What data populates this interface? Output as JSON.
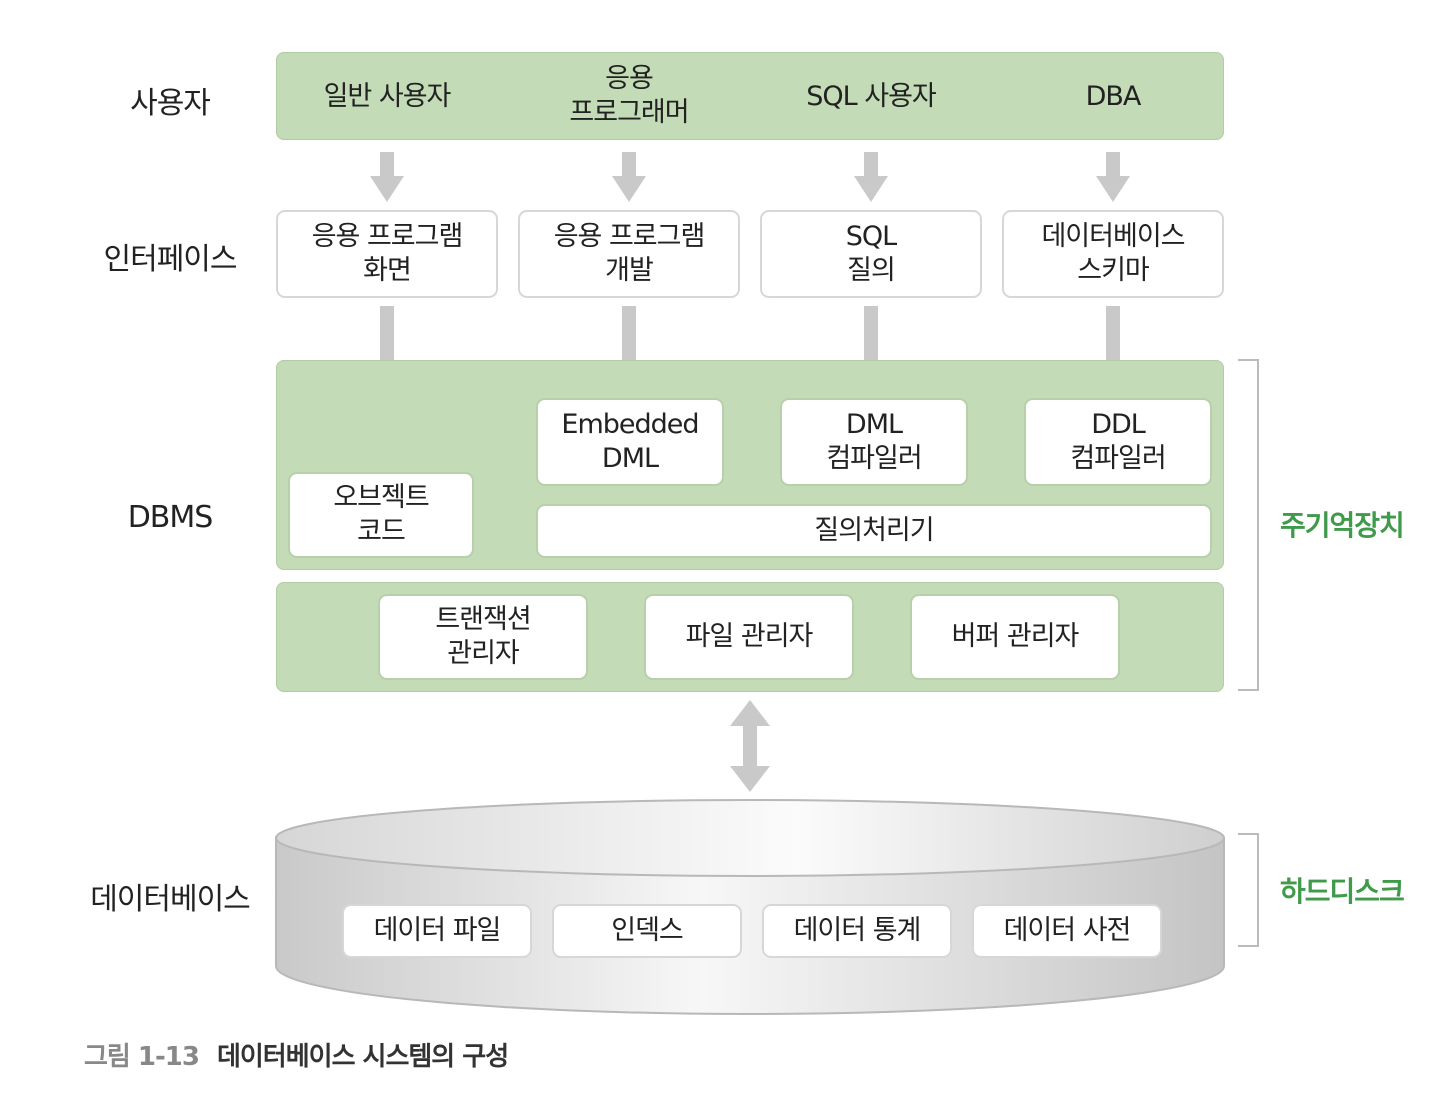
{
  "rows": {
    "users": "사용자",
    "interface": "인터페이스",
    "dbms": "DBMS",
    "database": "데이터베이스"
  },
  "users": [
    {
      "line1": "일반 사용자",
      "line2": ""
    },
    {
      "line1": "응용",
      "line2": "프로그래머"
    },
    {
      "line1": "SQL 사용자",
      "line2": ""
    },
    {
      "line1": "DBA",
      "line2": ""
    }
  ],
  "interfaces": [
    {
      "line1": "응용 프로그램",
      "line2": "화면"
    },
    {
      "line1": "응용 프로그램",
      "line2": "개발"
    },
    {
      "line1": "SQL",
      "line2": "질의"
    },
    {
      "line1": "데이터베이스",
      "line2": "스키마"
    }
  ],
  "dbms": {
    "embedded": {
      "line1": "Embedded",
      "line2": "DML"
    },
    "dml": {
      "line1": "DML",
      "line2": "컴파일러"
    },
    "ddl": {
      "line1": "DDL",
      "line2": "컴파일러"
    },
    "object_code": {
      "line1": "오브젝트",
      "line2": "코드"
    },
    "query_processor": "질의처리기",
    "transaction": {
      "line1": "트랜잭션",
      "line2": "관리자"
    },
    "file_manager": "파일 관리자",
    "buffer_manager": "버퍼 관리자"
  },
  "database_items": [
    "데이터 파일",
    "인덱스",
    "데이터 통계",
    "데이터 사전"
  ],
  "side_labels": {
    "main_memory": "주기억장치",
    "hard_disk": "하드디스크"
  },
  "caption": {
    "number": "그림 1-13",
    "title": "데이터베이스 시스템의 구성"
  }
}
